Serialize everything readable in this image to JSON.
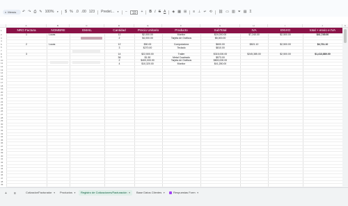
{
  "toolbar": {
    "menu_label": "Menús",
    "zoom": "100%",
    "currency": "$",
    "percent": "%",
    "decimal_dec": ".0",
    "decimal_inc": ".00",
    "number_format": "123",
    "font": "Predet...",
    "font_size": "10",
    "bold": "B",
    "italic": "I",
    "strike": "S",
    "text_color": "A"
  },
  "columns": [
    "A",
    "B",
    "C",
    "D",
    "E",
    "F",
    "G",
    "H",
    "I",
    "J",
    "K"
  ],
  "header": {
    "nro_factura": "NRO Factura",
    "nombre": "NOMBRE",
    "email": "EMAIL",
    "cantidad": "Cantidad",
    "precio_unitario": "Precio Unitario",
    "producto": "Producto",
    "subtotal": "SubTotal",
    "iva": "IVA",
    "envio": "ENVIO",
    "total": "total + envio e IVA"
  },
  "rows": [
    {
      "row": 2,
      "factura": "1",
      "nombre": "Lucas",
      "cantidad": "12",
      "precio": "$2,000.00",
      "producto": "Monitor",
      "subtotal": "$24,000.00",
      "iva": "$7,240.00",
      "envio": "$2,500.00",
      "total": "$41,745.00"
    },
    {
      "row": 3,
      "cantidad": "2",
      "precio": "$4,000.00",
      "producto": "Tarjeta de Gráficos",
      "subtotal": "$8,000.00"
    },
    {
      "row": 5,
      "factura": "2",
      "nombre": "Lucas",
      "cantidad": "12",
      "precio": "$50.00",
      "producto": "Computadora",
      "subtotal": "$600.00",
      "iva": "$821.10",
      "envio": "$2,500.00",
      "total": "$4,731.10"
    },
    {
      "row": 6,
      "cantidad": "3",
      "precio": "$270.00",
      "producto": "Teclado",
      "subtotal": "$810.00"
    },
    {
      "row": 8,
      "factura": "3",
      "cantidad": "14",
      "precio": "$22,500.00",
      "producto": "Trailer",
      "subtotal": "$315,000.00",
      "iva": "$245,385.00",
      "envio": "$2,500.00",
      "total": "$1,413,880.00"
    },
    {
      "row": 9,
      "cantidad": "36",
      "precio": "$1.50",
      "producto": "Metal Cuadrado",
      "subtotal": "$573.00"
    },
    {
      "row": 10,
      "cantidad": "2",
      "precio": "$400,000.00",
      "producto": "Tarjeta de Gráficos",
      "subtotal": "$800,000.00"
    },
    {
      "row": 11,
      "cantidad": "4",
      "precio": "$10,320.00",
      "producto": "Monitor",
      "subtotal": "$41,280.00"
    }
  ],
  "row_numbers": [
    "1",
    "2",
    "3",
    "4",
    "5",
    "6",
    "7",
    "8",
    "9",
    "10",
    "11",
    "12",
    "13",
    "14",
    "15",
    "16",
    "17",
    "18",
    "19",
    "20",
    "21",
    "22",
    "23",
    "24",
    "25",
    "26",
    "27",
    "28",
    "29",
    "30",
    "31",
    "32",
    "33",
    "34",
    "35",
    "36",
    "37",
    "38",
    "39",
    "40",
    "41",
    "42",
    "43",
    "44",
    "45",
    "46",
    "47",
    "48",
    "49",
    "50"
  ],
  "tabs": [
    {
      "label": "Cotizador/Facturador"
    },
    {
      "label": "Productos"
    },
    {
      "label": "Registro de Cotizaciones/Facturación",
      "active": true
    },
    {
      "label": "Base Datos Clientes"
    },
    {
      "label": "Respuestas Form"
    }
  ],
  "colors": {
    "header_bg": "#8b1247",
    "header_text": "#ffffff",
    "active_tab": "#e1f0ea"
  }
}
